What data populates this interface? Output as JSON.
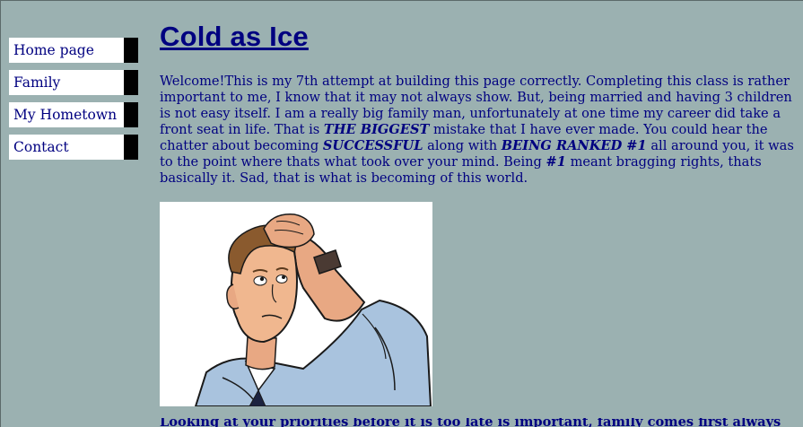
{
  "nav": {
    "items": [
      {
        "label": "Home page"
      },
      {
        "label": "Family"
      },
      {
        "label": "My Hometown"
      },
      {
        "label": "Contact"
      }
    ]
  },
  "page": {
    "title": "Cold as Ice",
    "paragraph": {
      "t1": "Welcome!This is my 7th attempt at building this page correctly. Completing this class is rather important to me, I know that it may not always show. But, being married and having 3 children is not easy itself. I am a really big family man, unfortunately at one time my career did take a front seat in life. That is ",
      "b1": "THE BIGGEST",
      "t2": " mistake that I have ever made. You could hear the chatter about becoming ",
      "b2": "SUCCESSFUL",
      "t3": " along with ",
      "b3": "BEING RANKED #1",
      "t4": " all around you, it was to the point where thats what took over your mind. Being ",
      "b4": "#1",
      "t5": " meant bragging rights, thats basically it. Sad, that is what is becoming of this world."
    },
    "cut_text": "Looking at your priorities before it is too late is important, family comes first always"
  },
  "colors": {
    "background": "#9bb1b1",
    "text": "#000080",
    "nav_bg": "#ffffff",
    "nav_edge": "#000000"
  },
  "image": {
    "icon": "confused-man-illustration"
  }
}
